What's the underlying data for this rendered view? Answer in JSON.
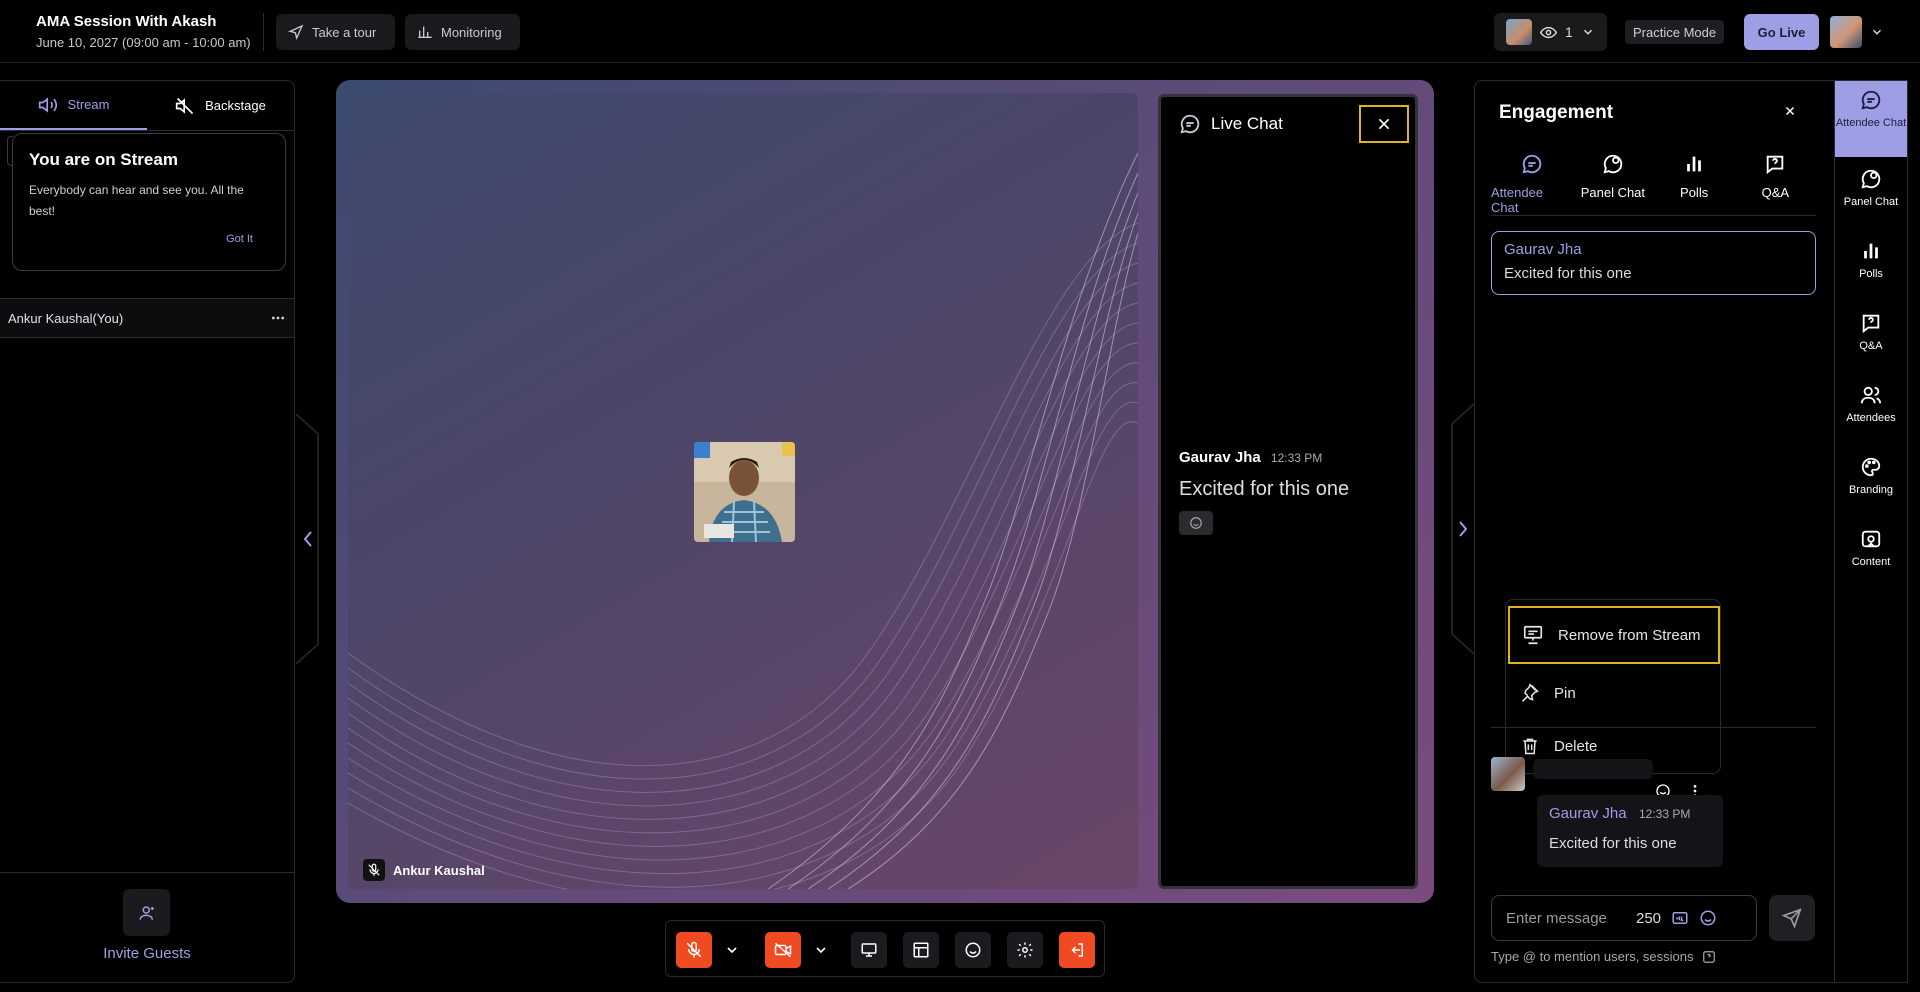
{
  "header": {
    "title": "AMA Session With Akash",
    "subtitle": "June 10, 2027 (09:00 am - 10:00 am)",
    "take_tour": "Take a tour",
    "monitoring": "Monitoring",
    "viewer_count": "1",
    "practice_mode": "Practice Mode",
    "go_live": "Go Live"
  },
  "left": {
    "tabs": [
      "Stream",
      "Backstage"
    ],
    "card_title": "You are on Stream",
    "card_text": "Everybody can hear and see you. All the best!",
    "got_it": "Got It",
    "participant": "Ankur Kaushal(You)",
    "invite": "Invite Guests"
  },
  "stage": {
    "speaker_name": "Ankur Kaushal",
    "live_chat_title": "Live Chat",
    "chat_name": "Gaurav Jha",
    "chat_time": "12:33 PM",
    "chat_text": "Excited for this one"
  },
  "engagement": {
    "title": "Engagement",
    "tabs": [
      "Attendee Chat",
      "Panel Chat",
      "Polls",
      "Q&A"
    ],
    "pinned_name": "Gaurav Jha",
    "pinned_text": "Excited for this one",
    "menu": [
      "Remove from Stream",
      "Pin",
      "Delete"
    ],
    "msg_name": "Gaurav Jha",
    "msg_time": "12:33 PM",
    "msg_text": "Excited for this one",
    "input_placeholder": "Enter message",
    "char_count": "250",
    "hint": "Type @ to mention users, sessions"
  },
  "rail": {
    "items": [
      "Attendee Chat",
      "Panel Chat",
      "Polls",
      "Q&A",
      "Attendees",
      "Branding",
      "Content"
    ]
  },
  "colors": {
    "accent": "#9d9ee6",
    "danger": "#f04a22",
    "focus": "#e0b21e"
  }
}
